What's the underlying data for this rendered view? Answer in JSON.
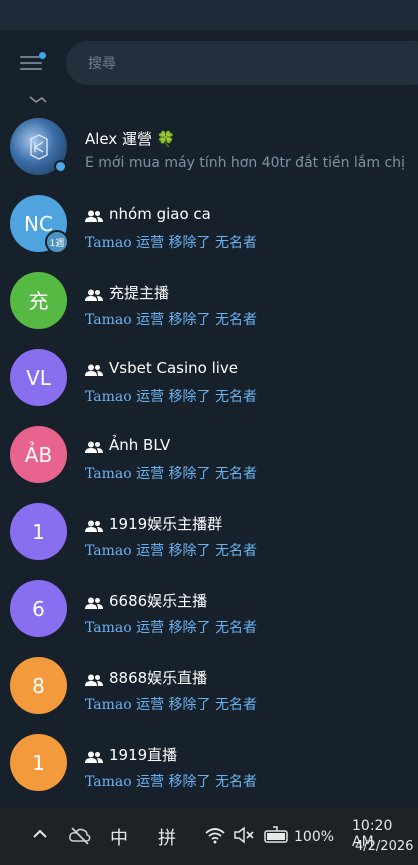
{
  "search": {
    "placeholder": "搜尋"
  },
  "chats": [
    {
      "name": "Alex 運營 🍀",
      "avatar_text": "",
      "avatar_color": "#2d4d7a",
      "is_group": false,
      "preview_plain": "E mới mua máy tính hơn 40tr đắt tiền lắm chị"
    },
    {
      "name": "nhóm giao ca",
      "avatar_text": "NC",
      "avatar_color": "#4fa3df",
      "is_group": true,
      "badge": "1週",
      "who": "Tamao",
      "action": " 运营 移除了 无名者"
    },
    {
      "name": "充提主播",
      "avatar_text": "充",
      "avatar_color": "#55b944",
      "is_group": true,
      "who": "Tamao",
      "action": " 运营 移除了 无名者"
    },
    {
      "name": "Vsbet Casino live",
      "avatar_text": "VL",
      "avatar_color": "#8a6ef0",
      "is_group": true,
      "who": "Tamao",
      "action": " 运营 移除了 无名者"
    },
    {
      "name": "Ảnh BLV",
      "avatar_text": "ẢB",
      "avatar_color": "#e8648f",
      "is_group": true,
      "who": "Tamao",
      "action": " 运营 移除了 无名者"
    },
    {
      "name": "1919娱乐主播群",
      "avatar_text": "1",
      "avatar_color": "#8a6ef0",
      "is_group": true,
      "who": "Tamao",
      "action": " 运营 移除了 无名者"
    },
    {
      "name": "6686娱乐主播",
      "avatar_text": "6",
      "avatar_color": "#8a6ef0",
      "is_group": true,
      "who": "Tamao",
      "action": " 运营 移除了 无名者"
    },
    {
      "name": "8868娱乐直播",
      "avatar_text": "8",
      "avatar_color": "#f39a3d",
      "is_group": true,
      "who": "Tamao",
      "action": " 运营 移除了 无名者"
    },
    {
      "name": "1919直播",
      "avatar_text": "1",
      "avatar_color": "#f39a3d",
      "is_group": true,
      "who": "Tamao",
      "action": " 运营 移除了 无名者"
    }
  ],
  "taskbar": {
    "ime_mode": "中",
    "ime_pinyin": "拼",
    "battery": "100%",
    "time": "10:20 AM",
    "date": "4/2/2026"
  }
}
